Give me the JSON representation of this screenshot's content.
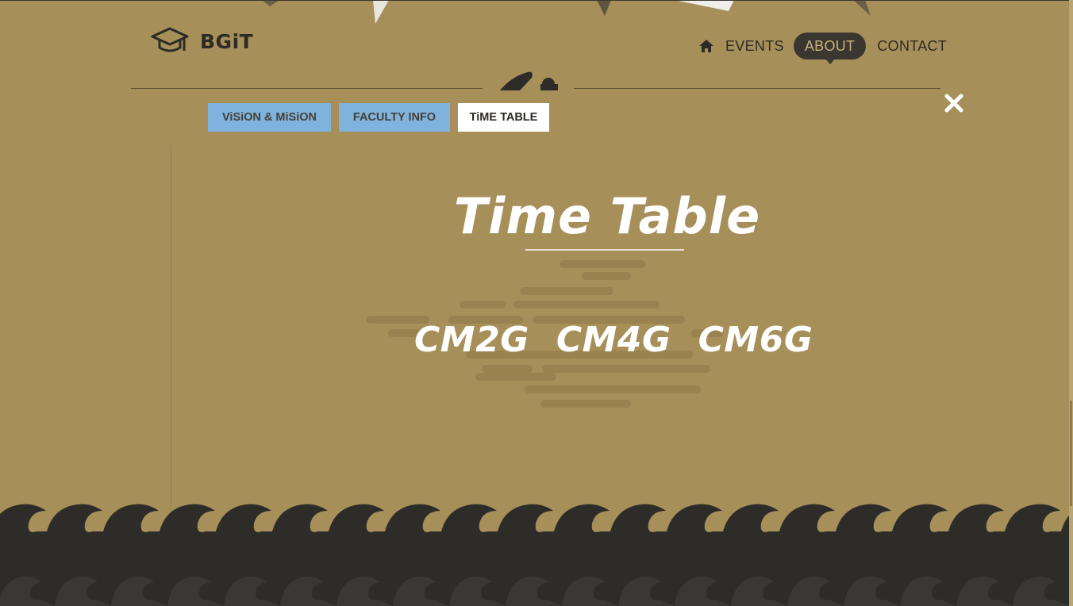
{
  "site": {
    "logo_text": "BGiT"
  },
  "nav": {
    "items": [
      {
        "label": "EVENTS",
        "active": false
      },
      {
        "label": "ABOUT",
        "active": true
      },
      {
        "label": "CONTACT",
        "active": false
      }
    ]
  },
  "tabs": [
    {
      "label": "ViSiON & MiSiON",
      "active": false
    },
    {
      "label": "FACULTY INFO",
      "active": false
    },
    {
      "label": "TiME TABLE",
      "active": true
    }
  ],
  "main": {
    "heading": "Time Table",
    "classes": [
      "CM2G",
      "CM4G",
      "CM6G"
    ]
  },
  "colors": {
    "background": "#a68f59",
    "dark": "#2d2b27",
    "tab_blue": "#7fb2dc",
    "tab_active": "#ffffff",
    "text_white": "#ffffff"
  },
  "icons": {
    "logo": "graduation-cap-icon",
    "home": "home-icon",
    "close": "close-icon"
  }
}
